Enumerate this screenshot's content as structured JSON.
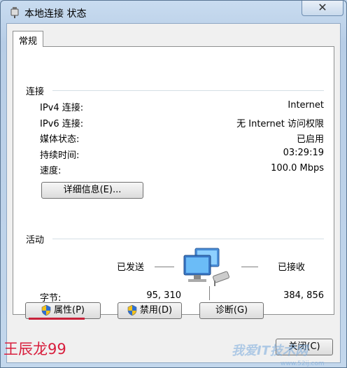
{
  "window": {
    "title": "本地连接 状态",
    "close_glyph": "✕"
  },
  "tabs": [
    {
      "label": "常规"
    }
  ],
  "connection": {
    "section_title": "连接",
    "rows": [
      {
        "label": "IPv4 连接:",
        "value": "Internet"
      },
      {
        "label": "IPv6 连接:",
        "value": "无 Internet 访问权限"
      },
      {
        "label": "媒体状态:",
        "value": "已启用"
      },
      {
        "label": "持续时间:",
        "value": "03:29:19"
      },
      {
        "label": "速度:",
        "value": "100.0 Mbps"
      }
    ],
    "details_button": "详细信息(E)..."
  },
  "activity": {
    "section_title": "活动",
    "sent_label": "已发送",
    "received_label": "已接收",
    "bytes_label": "字节:",
    "bytes_sent": "95, 310",
    "bytes_received": "384, 856"
  },
  "buttons": {
    "properties": "属性(P)",
    "disable": "禁用(D)",
    "diagnose": "诊断(G)",
    "close": "关闭(C)"
  },
  "overlay": {
    "author": "王辰龙99",
    "site": "我爱IT技术网",
    "url": "www.52ij.com"
  },
  "icons": {
    "title_icon": "network-adapter-icon",
    "network_icon": "network-computers-icon",
    "shield_icon": "uac-shield-icon"
  },
  "colors": {
    "title_bar": "#c9dcf0",
    "panel_bg": "#ffffff",
    "author_red": "#d81e3d"
  }
}
